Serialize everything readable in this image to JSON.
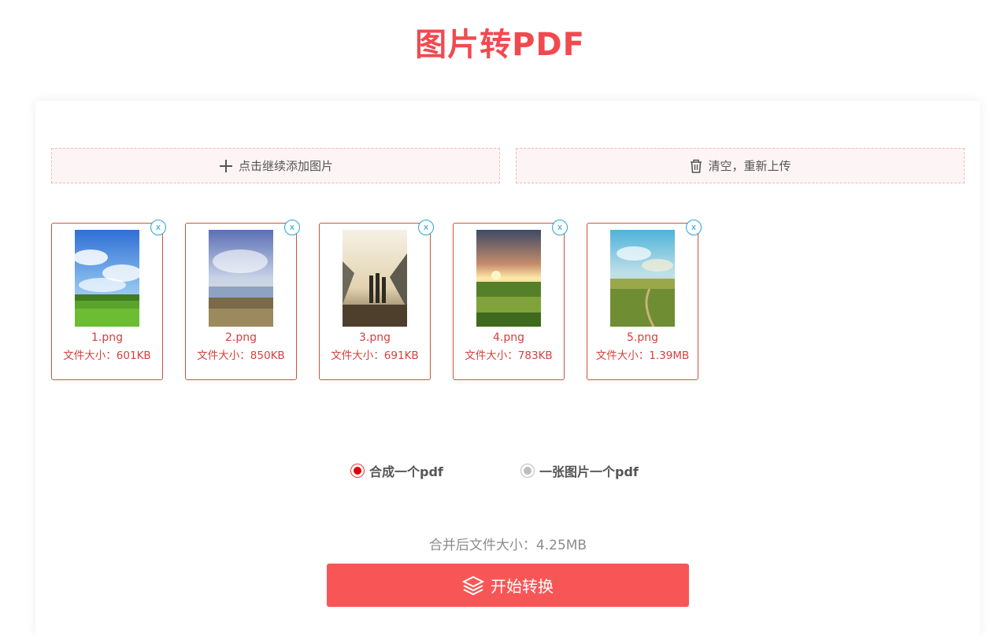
{
  "title": "图片转PDF",
  "actions": {
    "add_label": "点击继续添加图片",
    "clear_label": "清空，重新上传"
  },
  "files": [
    {
      "name": "1.png",
      "size": "文件大小：601KB",
      "remove": "x"
    },
    {
      "name": "2.png",
      "size": "文件大小：850KB",
      "remove": "x"
    },
    {
      "name": "3.png",
      "size": "文件大小：691KB",
      "remove": "x"
    },
    {
      "name": "4.png",
      "size": "文件大小：783KB",
      "remove": "x"
    },
    {
      "name": "5.png",
      "size": "文件大小：1.39MB",
      "remove": "x"
    }
  ],
  "modes": {
    "merge_label": "合成一个pdf",
    "separate_label": "一张图片一个pdf",
    "selected": "merge"
  },
  "merged_size": "合并后文件大小：4.25MB",
  "start_label": "开始转换",
  "colors": {
    "accent": "#f85656",
    "title": "#f04a4f",
    "file_text": "#d6403c",
    "remove_icon": "#2aa3d4"
  }
}
